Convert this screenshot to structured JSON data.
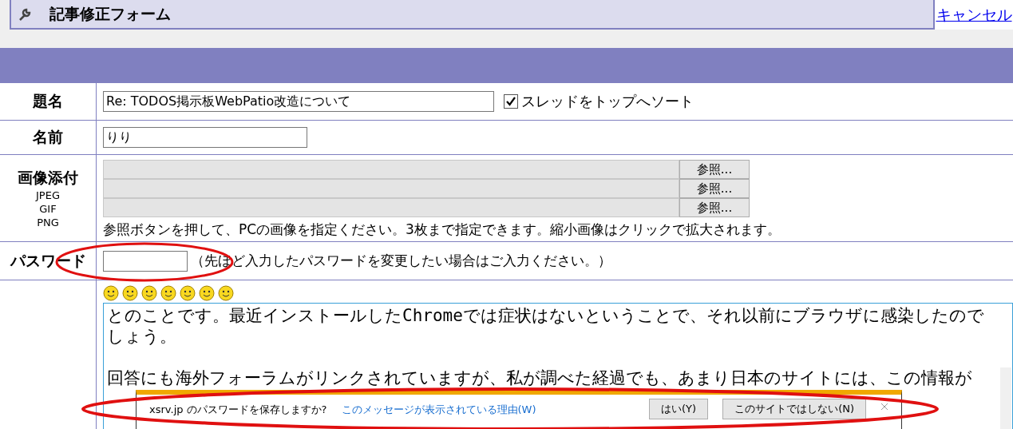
{
  "header": {
    "title": "記事修正フォーム",
    "cancel_link": "キャンセル"
  },
  "form": {
    "subject": {
      "label": "題名",
      "value": "Re: TODOS掲示板WebPatio改造について",
      "sort_checkbox": {
        "label": "スレッドをトップへソート",
        "checked": true
      }
    },
    "name": {
      "label": "名前",
      "value": "りり"
    },
    "images": {
      "label": "画像添付",
      "formats": [
        "JPEG",
        "GIF",
        "PNG"
      ],
      "browse_buttons": [
        "参照...",
        "参照...",
        "参照..."
      ],
      "note": "参照ボタンを押して、PCの画像を指定ください。3枚まで指定できます。縮小画像はクリックで拡大されます。"
    },
    "password": {
      "label": "パスワード",
      "note": "（先ほど入力したパスワードを変更したい場合はご入力ください。）"
    },
    "message": {
      "paragraphs": [
        [
          "とのことです。最近インストールしたChromeでは症状はないということで、それ以前にブラウザに感染したので",
          "しょう。"
        ],
        [
          "回答にも海外フォーラムがリンクされていますが、私が調べた経過でも、あまり日本のサイトには、この情報が"
        ]
      ]
    }
  },
  "password_prompt": {
    "question": "xsrv.jp のパスワードを保存しますか?",
    "reason_link": "このメッセージが表示されている理由(W)",
    "buttons": [
      "はい(Y)",
      "このサイトではしない(N)"
    ]
  }
}
